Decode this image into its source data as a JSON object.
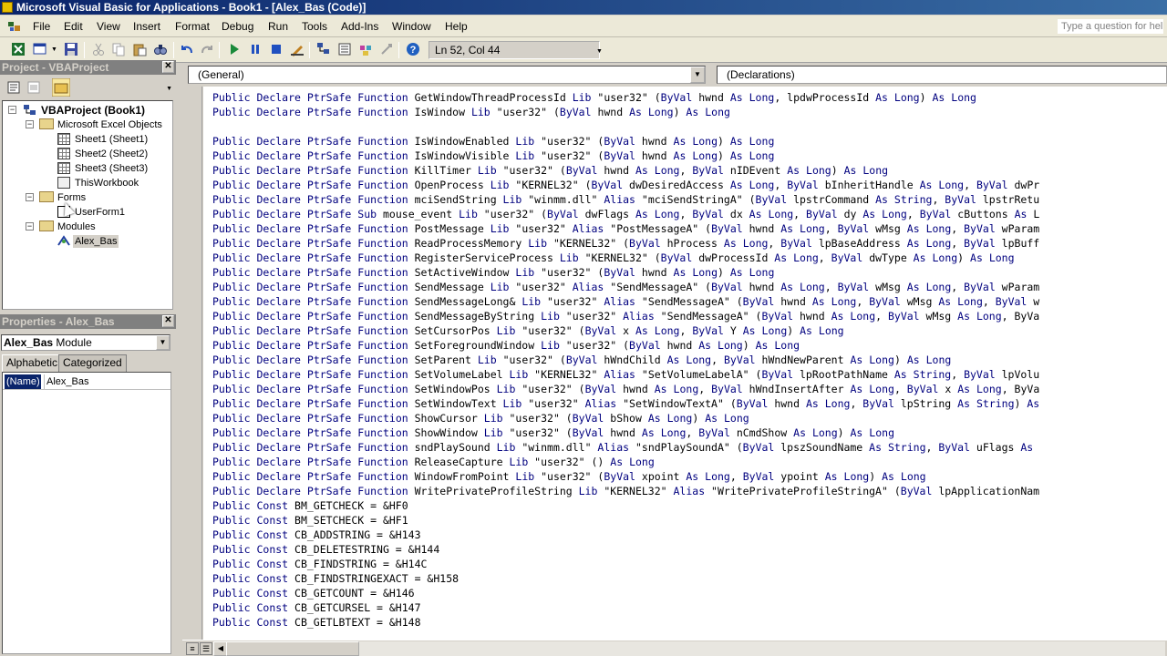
{
  "window": {
    "title": "Microsoft Visual Basic for Applications - Book1 - [Alex_Bas (Code)]"
  },
  "menu": {
    "items": [
      "File",
      "Edit",
      "View",
      "Insert",
      "Format",
      "Debug",
      "Run",
      "Tools",
      "Add-Ins",
      "Window",
      "Help"
    ],
    "help_placeholder": "Type a question for help"
  },
  "toolbar": {
    "position": "Ln 52, Col 44",
    "icons": [
      "view-excel-icon",
      "insert-userform-icon",
      "save-icon",
      "cut-icon",
      "copy-icon",
      "paste-icon",
      "find-icon",
      "undo-icon",
      "redo-icon",
      "run-icon",
      "break-icon",
      "reset-icon",
      "design-mode-icon",
      "project-explorer-icon",
      "properties-icon",
      "object-browser-icon",
      "toolbox-icon",
      "help-icon"
    ]
  },
  "project": {
    "title": "Project - VBAProject",
    "root": "VBAProject (Book1)",
    "folders": {
      "excel_objects": "Microsoft Excel Objects",
      "forms": "Forms",
      "modules": "Modules"
    },
    "sheets": [
      "Sheet1 (Sheet1)",
      "Sheet2 (Sheet2)",
      "Sheet3 (Sheet3)"
    ],
    "workbook": "ThisWorkbook",
    "form": "UserForm1",
    "module": "Alex_Bas"
  },
  "properties": {
    "title": "Properties - Alex_Bas",
    "object_name": "Alex_Bas",
    "object_type": "Module",
    "tabs": {
      "alphabetic": "Alphabetic",
      "categorized": "Categorized"
    },
    "row_name": "(Name)",
    "row_value": "Alex_Bas"
  },
  "code": {
    "object_combo": "(General)",
    "proc_combo": "(Declarations)",
    "lines": [
      "Public Declare PtrSafe Function GetWindowThreadProcessId Lib \"user32\" (ByVal hwnd As Long, lpdwProcessId As Long) As Long",
      "Public Declare PtrSafe Function IsWindow Lib \"user32\" (ByVal hwnd As Long) As Long",
      "",
      "Public Declare PtrSafe Function IsWindowEnabled Lib \"user32\" (ByVal hwnd As Long) As Long",
      "Public Declare PtrSafe Function IsWindowVisible Lib \"user32\" (ByVal hwnd As Long) As Long",
      "Public Declare PtrSafe Function KillTimer Lib \"user32\" (ByVal hwnd As Long, ByVal nIDEvent As Long) As Long",
      "Public Declare PtrSafe Function OpenProcess Lib \"KERNEL32\" (ByVal dwDesiredAccess As Long, ByVal bInheritHandle As Long, ByVal dwPr",
      "Public Declare PtrSafe Function mciSendString Lib \"winmm.dll\" Alias \"mciSendStringA\" (ByVal lpstrCommand As String, ByVal lpstrRetu",
      "Public Declare PtrSafe Sub mouse_event Lib \"user32\" (ByVal dwFlags As Long, ByVal dx As Long, ByVal dy As Long, ByVal cButtons As L",
      "Public Declare PtrSafe Function PostMessage Lib \"user32\" Alias \"PostMessageA\" (ByVal hwnd As Long, ByVal wMsg As Long, ByVal wParam",
      "Public Declare PtrSafe Function ReadProcessMemory Lib \"KERNEL32\" (ByVal hProcess As Long, ByVal lpBaseAddress As Long, ByVal lpBuff",
      "Public Declare PtrSafe Function RegisterServiceProcess Lib \"KERNEL32\" (ByVal dwProcessId As Long, ByVal dwType As Long) As Long",
      "Public Declare PtrSafe Function SetActiveWindow Lib \"user32\" (ByVal hwnd As Long) As Long",
      "Public Declare PtrSafe Function SendMessage Lib \"user32\" Alias \"SendMessageA\" (ByVal hwnd As Long, ByVal wMsg As Long, ByVal wParam",
      "Public Declare PtrSafe Function SendMessageLong& Lib \"user32\" Alias \"SendMessageA\" (ByVal hwnd As Long, ByVal wMsg As Long, ByVal w",
      "Public Declare PtrSafe Function SendMessageByString Lib \"user32\" Alias \"SendMessageA\" (ByVal hwnd As Long, ByVal wMsg As Long, ByVa",
      "Public Declare PtrSafe Function SetCursorPos Lib \"user32\" (ByVal x As Long, ByVal Y As Long) As Long",
      "Public Declare PtrSafe Function SetForegroundWindow Lib \"user32\" (ByVal hwnd As Long) As Long",
      "Public Declare PtrSafe Function SetParent Lib \"user32\" (ByVal hWndChild As Long, ByVal hWndNewParent As Long) As Long",
      "Public Declare PtrSafe Function SetVolumeLabel Lib \"KERNEL32\" Alias \"SetVolumeLabelA\" (ByVal lpRootPathName As String, ByVal lpVolu",
      "Public Declare PtrSafe Function SetWindowPos Lib \"user32\" (ByVal hwnd As Long, ByVal hWndInsertAfter As Long, ByVal x As Long, ByVa",
      "Public Declare PtrSafe Function SetWindowText Lib \"user32\" Alias \"SetWindowTextA\" (ByVal hwnd As Long, ByVal lpString As String) As",
      "Public Declare PtrSafe Function ShowCursor Lib \"user32\" (ByVal bShow As Long) As Long",
      "Public Declare PtrSafe Function ShowWindow Lib \"user32\" (ByVal hwnd As Long, ByVal nCmdShow As Long) As Long",
      "Public Declare PtrSafe Function sndPlaySound Lib \"winmm.dll\" Alias \"sndPlaySoundA\" (ByVal lpszSoundName As String, ByVal uFlags As",
      "Public Declare PtrSafe Function ReleaseCapture Lib \"user32\" () As Long",
      "Public Declare PtrSafe Function WindowFromPoint Lib \"user32\" (ByVal xpoint As Long, ByVal ypoint As Long) As Long",
      "Public Declare PtrSafe Function WritePrivateProfileString Lib \"KERNEL32\" Alias \"WritePrivateProfileStringA\" (ByVal lpApplicationNam",
      "Public Const BM_GETCHECK = &HF0",
      "Public Const BM_SETCHECK = &HF1",
      "Public Const CB_ADDSTRING = &H143",
      "Public Const CB_DELETESTRING = &H144",
      "Public Const CB_FINDSTRING = &H14C",
      "Public Const CB_FINDSTRINGEXACT = &H158",
      "Public Const CB_GETCOUNT = &H146",
      "Public Const CB_GETCURSEL = &H147",
      "Public Const CB_GETLBTEXT = &H148"
    ]
  },
  "colors": {
    "keyword": "#00007f",
    "titlebar": "#0a246a"
  }
}
